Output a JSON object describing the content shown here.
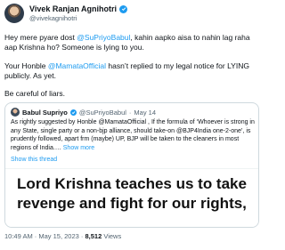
{
  "author": {
    "name": "Vivek Ranjan Agnihotri",
    "handle": "@vivekagnihotri"
  },
  "tweet": {
    "line1_prefix": "Hey mere pyare dost ",
    "line1_mention": "@SuPriyoBabul",
    "line1_suffix": ", kahin aapko aisa to nahin lag raha aap Krishna ho? Someone is lying to you.",
    "line2_prefix": "Your Honble ",
    "line2_mention": "@MamataOfficial",
    "line2_suffix": " hasn’t replied to my legal notice for LYING publicly. As yet.",
    "line3": "Be careful of liars."
  },
  "quote": {
    "name": "Babul Supriyo",
    "handle": "@SuPriyoBabul",
    "separator": "·",
    "date": "May 14",
    "text": "As rightly suggested by Honble @MamataOfficial , If the formula of ‘Whoever is strong in any State, single party or a non-bjp alliance, should take-on @BJP4India one-2-one’, is prudently followed, apart frm (maybe) UP, BJP will be taken to the cleaners in most regions of India.…",
    "show_more": "Show more",
    "show_thread": "Show this thread",
    "image_line1": "Lord Krishna teaches us to take",
    "image_line2": "revenge and fight for our rights,"
  },
  "footer": {
    "time_date": "10:49 AM · May 15, 2023 · ",
    "views_count": "8,512",
    "views_label": " Views"
  },
  "colors": {
    "link": "#1d9bf0",
    "text": "#0f1419",
    "muted": "#536471",
    "border": "#cfd9de"
  },
  "icons": [
    "verified-badge-icon"
  ]
}
